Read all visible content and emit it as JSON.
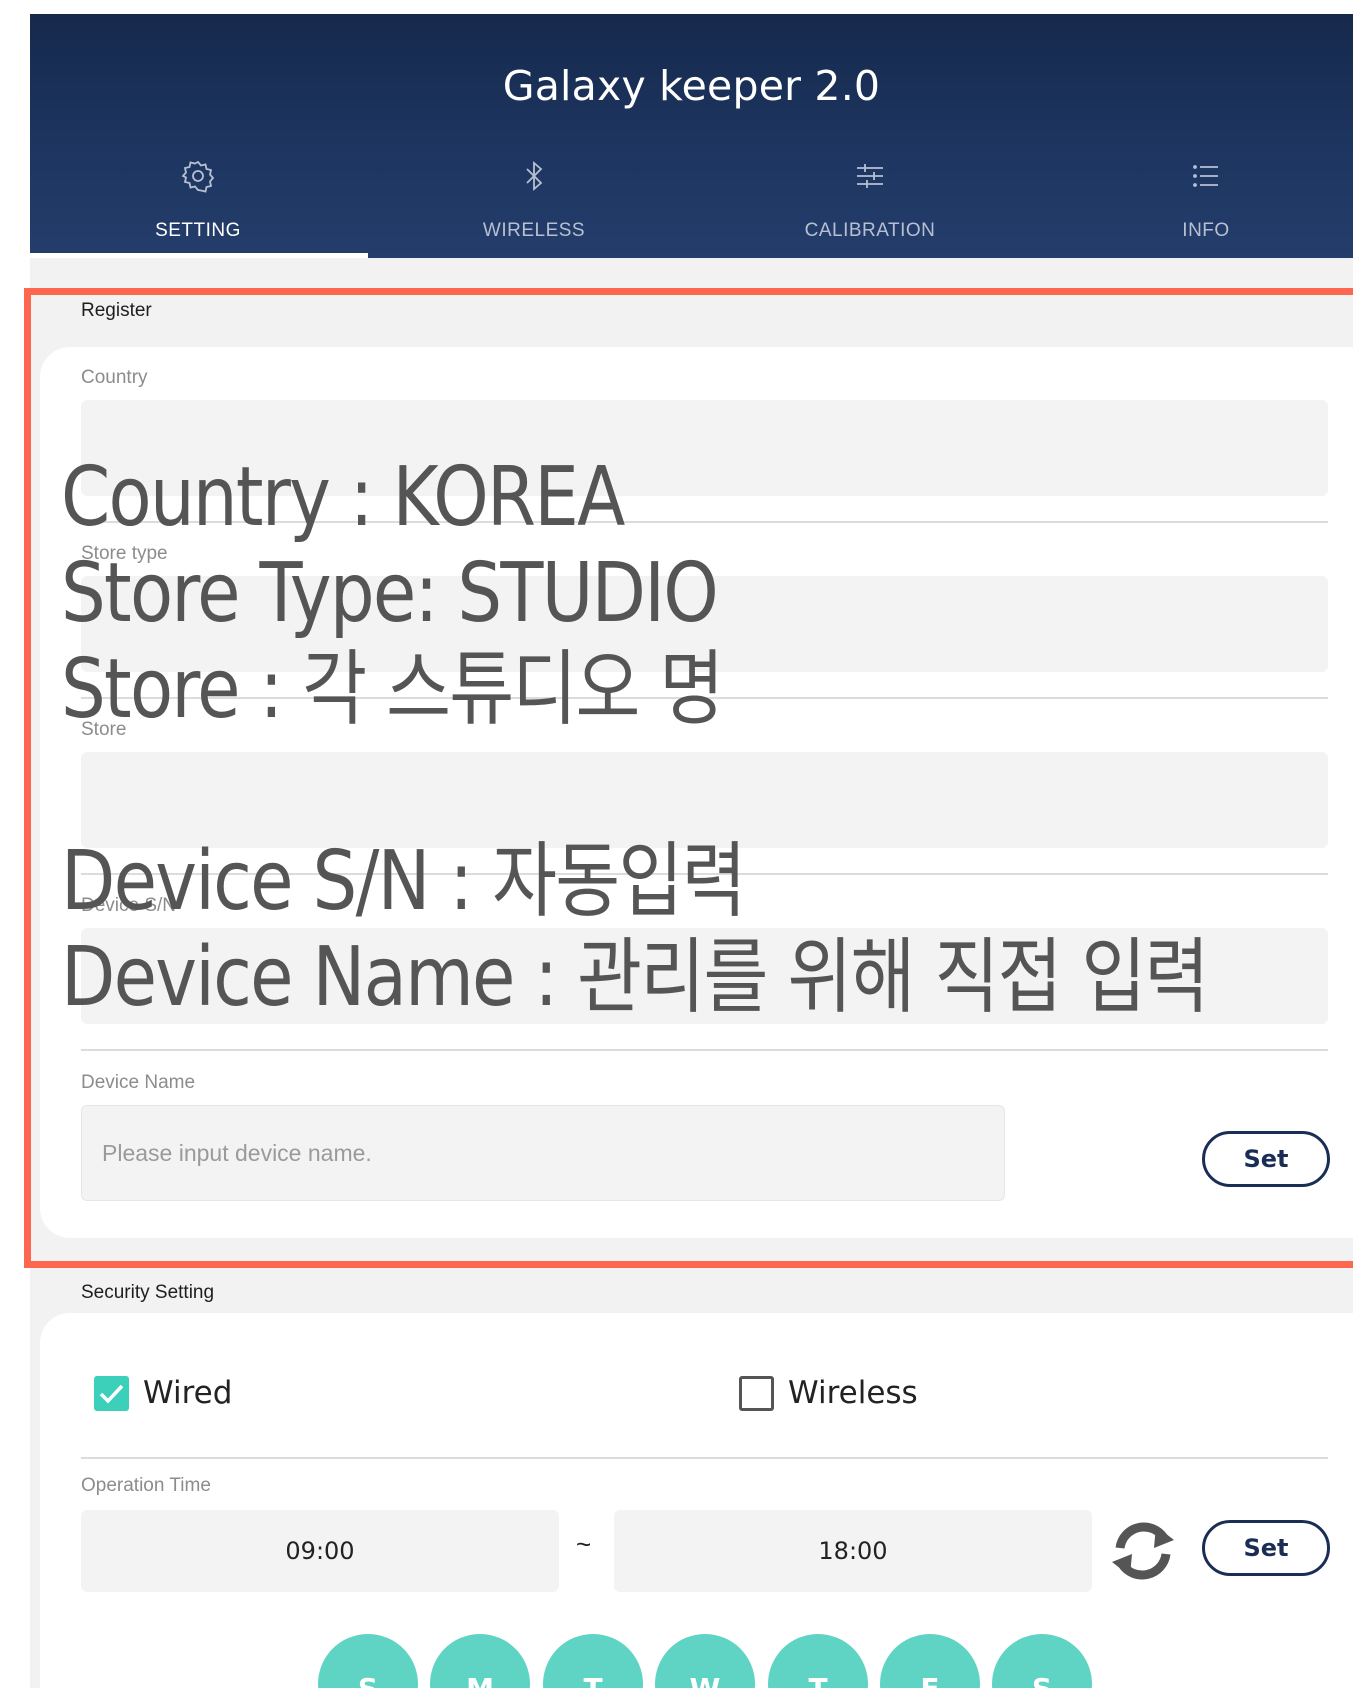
{
  "app_title": "Galaxy keeper 2.0",
  "tabs": [
    {
      "label": "SETTING",
      "icon": "gear-icon",
      "active": true
    },
    {
      "label": "WIRELESS",
      "icon": "bluetooth-icon",
      "active": false
    },
    {
      "label": "CALIBRATION",
      "icon": "sliders-icon",
      "active": false
    },
    {
      "label": "INFO",
      "icon": "list-icon",
      "active": false
    }
  ],
  "register": {
    "section_title": "Register",
    "fields": [
      {
        "label": "Country",
        "value": ""
      },
      {
        "label": "Store type",
        "value": ""
      },
      {
        "label": "Store",
        "value": ""
      },
      {
        "label": "Device S/N",
        "value": ""
      }
    ],
    "device_name": {
      "label": "Device Name",
      "placeholder": "Please input device name.",
      "value": ""
    },
    "set_label": "Set"
  },
  "annotation": {
    "color": "#fd664f",
    "lines": [
      "Country : KOREA",
      "Store Type: STUDIO",
      "Store : 각 스튜디오 명",
      "",
      "Device S/N : 자동입력",
      "Device Name : 관리를 위해 직접 입력"
    ]
  },
  "security": {
    "section_title": "Security Setting",
    "wired": {
      "label": "Wired",
      "checked": true
    },
    "wireless": {
      "label": "Wireless",
      "checked": false
    },
    "operation_time_label": "Operation Time",
    "start_time": "09:00",
    "separator": "~",
    "end_time": "18:00",
    "set_label": "Set",
    "days": [
      "S",
      "M",
      "T",
      "W",
      "T",
      "F",
      "S"
    ]
  },
  "colors": {
    "header": "#1d3560",
    "accent": "#3ccfba",
    "day_button": "#5fd3c4",
    "button_border": "#1a2d55"
  }
}
